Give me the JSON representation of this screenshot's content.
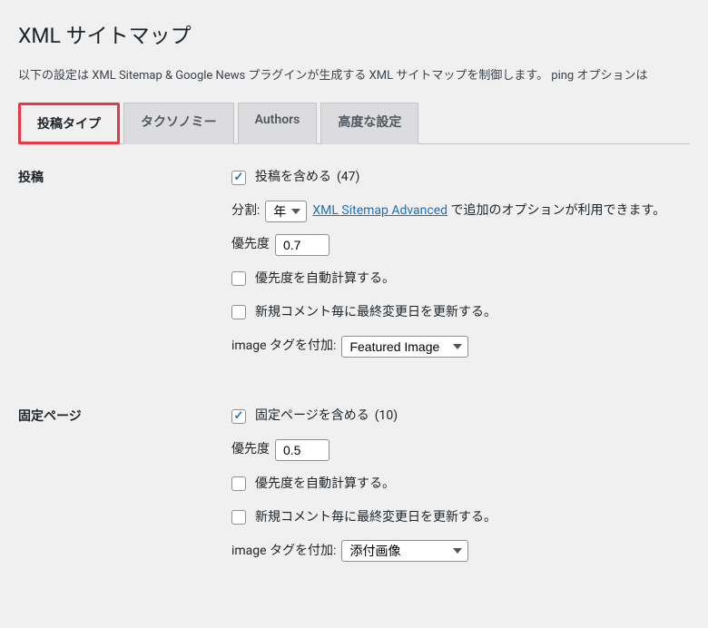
{
  "page": {
    "title": "XML サイトマップ",
    "description": "以下の設定は XML Sitemap & Google News プラグインが生成する XML サイトマップを制御します。 ping オプションは"
  },
  "tabs": [
    {
      "label": "投稿タイプ",
      "active": true,
      "highlighted": true
    },
    {
      "label": "タクソノミー",
      "active": false,
      "highlighted": false
    },
    {
      "label": "Authors",
      "active": false,
      "highlighted": false
    },
    {
      "label": "高度な設定",
      "active": false,
      "highlighted": false
    }
  ],
  "sections": {
    "posts": {
      "heading": "投稿",
      "include_label": "投稿を含める",
      "include_count": "(47)",
      "split_label": "分割:",
      "split_value": "年",
      "advanced_link": "XML Sitemap Advanced",
      "advanced_after": " で追加のオプションが利用できます。",
      "priority_label": "優先度",
      "priority_value": "0.7",
      "auto_priority_label": "優先度を自動計算する。",
      "update_on_comment_label": "新規コメント毎に最終変更日を更新する。",
      "image_tag_label": "image タグを付加:",
      "image_tag_value": "Featured Image"
    },
    "pages": {
      "heading": "固定ページ",
      "include_label": "固定ページを含める",
      "include_count": "(10)",
      "priority_label": "優先度",
      "priority_value": "0.5",
      "auto_priority_label": "優先度を自動計算する。",
      "update_on_comment_label": "新規コメント毎に最終変更日を更新する。",
      "image_tag_label": "image タグを付加:",
      "image_tag_value": "添付画像"
    }
  }
}
